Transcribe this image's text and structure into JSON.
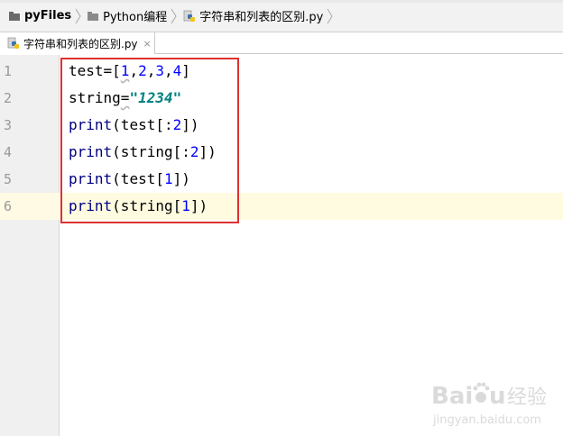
{
  "breadcrumb": {
    "project": "pyFiles",
    "folder": "Python编程",
    "file": "字符串和列表的区别.py"
  },
  "tab": {
    "label": "字符串和列表的区别.py",
    "close_glyph": "×"
  },
  "editor": {
    "line_numbers": [
      "1",
      "2",
      "3",
      "4",
      "5",
      "6"
    ],
    "current_line": 6,
    "lines": [
      [
        {
          "t": "test=[",
          "c": "plain"
        },
        {
          "t": "1",
          "c": "num",
          "u": true
        },
        {
          "t": ",",
          "c": "plain"
        },
        {
          "t": "2",
          "c": "num"
        },
        {
          "t": ",",
          "c": "plain"
        },
        {
          "t": "3",
          "c": "num"
        },
        {
          "t": ",",
          "c": "plain"
        },
        {
          "t": "4",
          "c": "num"
        },
        {
          "t": "]",
          "c": "plain"
        }
      ],
      [
        {
          "t": "string",
          "c": "plain"
        },
        {
          "t": "=",
          "c": "plain",
          "u": true
        },
        {
          "t": "\"1234\"",
          "c": "str"
        }
      ],
      [
        {
          "t": "print",
          "c": "kw"
        },
        {
          "t": "(test[:",
          "c": "plain"
        },
        {
          "t": "2",
          "c": "num"
        },
        {
          "t": "])",
          "c": "plain"
        }
      ],
      [
        {
          "t": "print",
          "c": "kw"
        },
        {
          "t": "(string[:",
          "c": "plain"
        },
        {
          "t": "2",
          "c": "num"
        },
        {
          "t": "])",
          "c": "plain"
        }
      ],
      [
        {
          "t": "print",
          "c": "kw"
        },
        {
          "t": "(test[",
          "c": "plain"
        },
        {
          "t": "1",
          "c": "num"
        },
        {
          "t": "])",
          "c": "plain"
        }
      ],
      [
        {
          "t": "print",
          "c": "kw"
        },
        {
          "t": "(string[",
          "c": "plain"
        },
        {
          "t": "1",
          "c": "num"
        },
        {
          "t": "])",
          "c": "plain"
        }
      ]
    ]
  },
  "colors": {
    "highlight_border": "#e03030",
    "caret_row": "#fffbe0",
    "number": "#0000ff",
    "builtin": "#000080",
    "string": "#008080"
  },
  "watermark": {
    "brand": "Baidu经验",
    "url": "jingyan.baidu.com"
  }
}
